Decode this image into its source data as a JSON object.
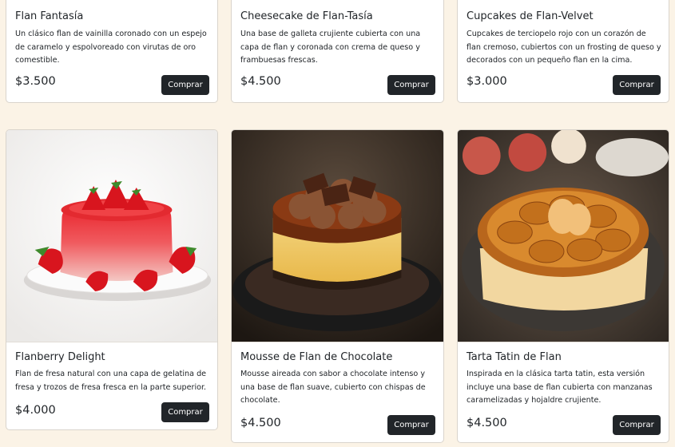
{
  "currency": "$",
  "products": [
    {
      "title": "Flan Fantasía",
      "description": "Un clásico flan de vainilla coronado con un espejo de caramelo y espolvoreado con virutas de oro comestible.",
      "price": "$3.500",
      "button_label": "Comprar"
    },
    {
      "title": "Cheesecake de Flan-Tasía",
      "description": "Una base de galleta crujiente cubierta con una capa de flan y coronada con crema de queso y frambuesas frescas.",
      "price": "$4.500",
      "button_label": "Comprar"
    },
    {
      "title": "Cupcakes de Flan-Velvet",
      "description": "Cupcakes de terciopelo rojo con un corazón de flan cremoso, cubiertos con un frosting de queso y decorados con un pequeño flan en la cima.",
      "price": "$3.000",
      "button_label": "Comprar"
    },
    {
      "title": "Flanberry Delight",
      "description": "Flan de fresa natural con una capa de gelatina de fresa y trozos de fresa fresca en la parte superior.",
      "price": "$4.000",
      "button_label": "Comprar",
      "image_icon": "strawberry-flan-image"
    },
    {
      "title": "Mousse de Flan de Chocolate",
      "description": "Mousse aireada con sabor a chocolate intenso y una base de flan suave, cubierto con chispas de chocolate.",
      "price": "$4.500",
      "button_label": "Comprar",
      "image_icon": "chocolate-flan-image"
    },
    {
      "title": "Tarta Tatin de Flan",
      "description": "Inspirada en la clásica tarta tatin, esta versión incluye una base de flan cubierta con manzanas caramelizadas y hojaldre crujiente.",
      "price": "$4.500",
      "button_label": "Comprar",
      "image_icon": "apple-tart-image"
    }
  ],
  "colors": {
    "page_background": "#fbf3e6",
    "button_background": "#212529",
    "button_text": "#ffffff",
    "card_border": "#d9d4cc"
  }
}
